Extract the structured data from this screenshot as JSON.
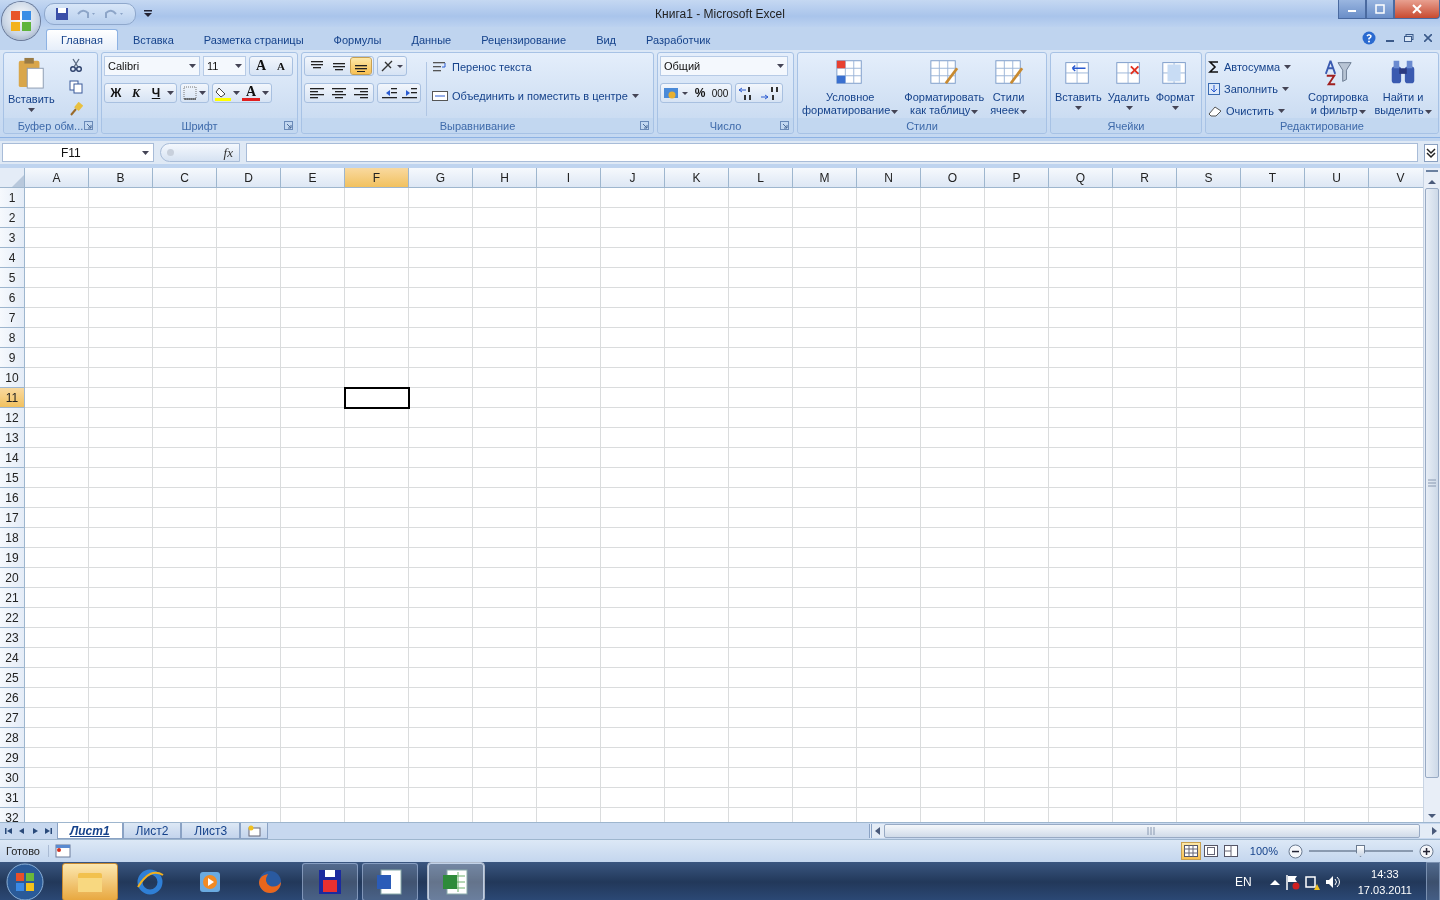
{
  "window": {
    "title": "Книга1 - Microsoft Excel"
  },
  "tabs": [
    {
      "label": "Главная",
      "selected": true
    },
    {
      "label": "Вставка",
      "selected": false
    },
    {
      "label": "Разметка страницы",
      "selected": false
    },
    {
      "label": "Формулы",
      "selected": false
    },
    {
      "label": "Данные",
      "selected": false
    },
    {
      "label": "Рецензирование",
      "selected": false
    },
    {
      "label": "Вид",
      "selected": false
    },
    {
      "label": "Разработчик",
      "selected": false
    }
  ],
  "ribbon": [
    {
      "kind": "clipboard",
      "name": "Буфер обм...",
      "paste": "Вставить"
    },
    {
      "kind": "font",
      "name": "Шрифт",
      "font": "Calibri",
      "size": "11",
      "grow": "A",
      "shrink": "A",
      "bold": "Ж",
      "italic": "К",
      "underline": "Ч",
      "font_color": "A"
    },
    {
      "kind": "alignment",
      "name": "Выравнивание",
      "vertical": [
        {
          "selected": false
        },
        {
          "selected": false
        },
        {
          "selected": true
        }
      ],
      "wrap": "Перенос текста",
      "merge": "Объединить и поместить в центре"
    },
    {
      "kind": "number",
      "name": "Число",
      "format": "Общий",
      "percent": "%",
      "thousands": "000"
    },
    {
      "kind": "styles",
      "name": "Стили",
      "buttons": [
        {
          "lines": [
            "Условное",
            "форматирование"
          ]
        },
        {
          "lines": [
            "Форматировать",
            "как таблицу"
          ]
        },
        {
          "lines": [
            "Стили",
            "ячеек"
          ]
        }
      ]
    },
    {
      "kind": "cells",
      "name": "Ячейки",
      "buttons": [
        "Вставить",
        "Удалить",
        "Формат"
      ]
    },
    {
      "kind": "editing",
      "name": "Редактирование",
      "small": [
        "Автосумма",
        "Заполнить",
        "Очистить"
      ],
      "large": [
        {
          "lines": [
            "Сортировка",
            "и фильтр"
          ]
        },
        {
          "lines": [
            "Найти и",
            "выделить"
          ]
        }
      ]
    }
  ],
  "formula_bar": {
    "name_box": "F11",
    "fx": "fx"
  },
  "sheet": {
    "columns": [
      {
        "label": "A",
        "selected": false
      },
      {
        "label": "B",
        "selected": false
      },
      {
        "label": "C",
        "selected": false
      },
      {
        "label": "D",
        "selected": false
      },
      {
        "label": "E",
        "selected": false
      },
      {
        "label": "F",
        "selected": true
      },
      {
        "label": "G",
        "selected": false
      },
      {
        "label": "H",
        "selected": false
      },
      {
        "label": "I",
        "selected": false
      },
      {
        "label": "J",
        "selected": false
      },
      {
        "label": "K",
        "selected": false
      },
      {
        "label": "L",
        "selected": false
      },
      {
        "label": "M",
        "selected": false
      },
      {
        "label": "N",
        "selected": false
      },
      {
        "label": "O",
        "selected": false
      },
      {
        "label": "P",
        "selected": false
      },
      {
        "label": "Q",
        "selected": false
      },
      {
        "label": "R",
        "selected": false
      },
      {
        "label": "S",
        "selected": false
      },
      {
        "label": "T",
        "selected": false
      },
      {
        "label": "U",
        "selected": false
      },
      {
        "label": "V",
        "selected": false
      }
    ],
    "rows": [
      {
        "label": "1",
        "selected": false
      },
      {
        "label": "2",
        "selected": false
      },
      {
        "label": "3",
        "selected": false
      },
      {
        "label": "4",
        "selected": false
      },
      {
        "label": "5",
        "selected": false
      },
      {
        "label": "6",
        "selected": false
      },
      {
        "label": "7",
        "selected": false
      },
      {
        "label": "8",
        "selected": false
      },
      {
        "label": "9",
        "selected": false
      },
      {
        "label": "10",
        "selected": false
      },
      {
        "label": "11",
        "selected": true
      },
      {
        "label": "12",
        "selected": false
      },
      {
        "label": "13",
        "selected": false
      },
      {
        "label": "14",
        "selected": false
      },
      {
        "label": "15",
        "selected": false
      },
      {
        "label": "16",
        "selected": false
      },
      {
        "label": "17",
        "selected": false
      },
      {
        "label": "18",
        "selected": false
      },
      {
        "label": "19",
        "selected": false
      },
      {
        "label": "20",
        "selected": false
      },
      {
        "label": "21",
        "selected": false
      },
      {
        "label": "22",
        "selected": false
      },
      {
        "label": "23",
        "selected": false
      },
      {
        "label": "24",
        "selected": false
      },
      {
        "label": "25",
        "selected": false
      },
      {
        "label": "26",
        "selected": false
      },
      {
        "label": "27",
        "selected": false
      },
      {
        "label": "28",
        "selected": false
      },
      {
        "label": "29",
        "selected": false
      },
      {
        "label": "30",
        "selected": false
      },
      {
        "label": "31",
        "selected": false
      },
      {
        "label": "32",
        "selected": false
      }
    ]
  },
  "sheet_tabs": [
    {
      "label": "Лист1",
      "selected": true
    },
    {
      "label": "Лист2",
      "selected": false
    },
    {
      "label": "Лист3",
      "selected": false
    }
  ],
  "status_bar": {
    "text": "Готово",
    "views": [
      {
        "selected": true
      },
      {
        "selected": false
      },
      {
        "selected": false
      }
    ],
    "zoom": "100%",
    "zoom_slider": {
      "level": 0.5
    }
  },
  "taskbar": {
    "apps": [
      {
        "kind": "folder",
        "highlighted": true,
        "running": false,
        "selected": false
      },
      {
        "kind": "browser",
        "highlighted": false,
        "running": false,
        "selected": false
      },
      {
        "kind": "player",
        "highlighted": false,
        "running": false,
        "selected": false
      },
      {
        "kind": "fox",
        "highlighted": false,
        "running": false,
        "selected": false
      },
      {
        "kind": "floppy",
        "highlighted": false,
        "running": true,
        "selected": false
      },
      {
        "kind": "word",
        "highlighted": false,
        "running": true,
        "selected": false
      },
      {
        "kind": "excel",
        "highlighted": false,
        "running": true,
        "selected": true
      }
    ],
    "language": "EN",
    "time": "14:33",
    "date": "17.03.2011"
  }
}
